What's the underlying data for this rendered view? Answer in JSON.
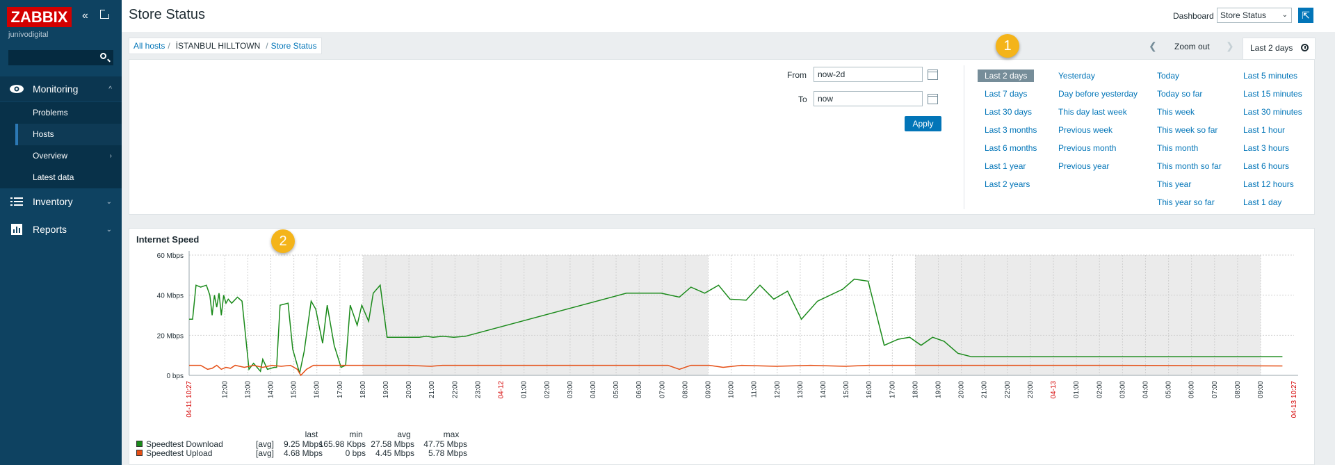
{
  "sidebar": {
    "logo": "ZABBIX",
    "org": "junivodigital",
    "search_placeholder": "",
    "nav": [
      {
        "label": "Monitoring",
        "icon": "eye-icon"
      },
      {
        "label": "Inventory",
        "icon": "list-icon"
      },
      {
        "label": "Reports",
        "icon": "bar-chart-icon"
      }
    ],
    "submenu": [
      "Problems",
      "Hosts",
      "Overview",
      "Latest data"
    ]
  },
  "header": {
    "title": "Store Status",
    "dashboard_label": "Dashboard",
    "dashboard_value": "Store Status"
  },
  "breadcrumb": [
    "All hosts",
    "İSTANBUL HILLTOWN",
    "Store Status"
  ],
  "timebar": {
    "zoom_out": "Zoom out",
    "period": "Last 2 days"
  },
  "filter": {
    "from_label": "From",
    "from_value": "now-2d",
    "to_label": "To",
    "to_value": "now",
    "apply": "Apply",
    "quick_periods": [
      [
        "Last 2 days",
        "Last 7 days",
        "Last 30 days",
        "Last 3 months",
        "Last 6 months",
        "Last 1 year",
        "Last 2 years"
      ],
      [
        "Yesterday",
        "Day before yesterday",
        "This day last week",
        "Previous week",
        "Previous month",
        "Previous year"
      ],
      [
        "Today",
        "Today so far",
        "This week",
        "This week so far",
        "This month",
        "This month so far",
        "This year",
        "This year so far"
      ],
      [
        "Last 5 minutes",
        "Last 15 minutes",
        "Last 30 minutes",
        "Last 1 hour",
        "Last 3 hours",
        "Last 6 hours",
        "Last 12 hours",
        "Last 1 day"
      ]
    ]
  },
  "badges": [
    "1",
    "2"
  ],
  "widget": {
    "title": "Internet Speed"
  },
  "chart_data": {
    "type": "line",
    "title": "Internet Speed",
    "ylabel": "",
    "y_unit": "Mbps",
    "ylim": [
      0,
      60
    ],
    "y_ticks": [
      "0 bps",
      "20 Mbps",
      "40 Mbps",
      "60 Mbps"
    ],
    "x_start_label": "04-11 10:27",
    "x_end_label": "04-13 10:27",
    "x_ticks": [
      "12:00",
      "13:00",
      "14:00",
      "15:00",
      "16:00",
      "17:00",
      "18:00",
      "19:00",
      "20:00",
      "21:00",
      "22:00",
      "23:00",
      "04-12",
      "01:00",
      "02:00",
      "03:00",
      "04:00",
      "05:00",
      "06:00",
      "07:00",
      "08:00",
      "09:00",
      "10:00",
      "11:00",
      "12:00",
      "13:00",
      "14:00",
      "15:00",
      "16:00",
      "17:00",
      "18:00",
      "19:00",
      "20:00",
      "21:00",
      "22:00",
      "23:00",
      "04-13",
      "01:00",
      "02:00",
      "03:00",
      "04:00",
      "05:00",
      "06:00",
      "07:00",
      "08:00",
      "09:00"
    ],
    "red_ticks": [
      "04-12",
      "04-13"
    ],
    "night_shading": [
      [
        "18:00",
        "09:00"
      ],
      [
        "18:00",
        "09:00"
      ]
    ],
    "series": [
      {
        "name": "Speedtest Download",
        "color": "#1a8a1a",
        "points": [
          [
            0,
            28
          ],
          [
            0.15,
            28
          ],
          [
            0.3,
            45
          ],
          [
            0.5,
            44
          ],
          [
            0.75,
            45
          ],
          [
            0.9,
            40
          ],
          [
            1.0,
            30
          ],
          [
            1.1,
            40
          ],
          [
            1.2,
            34
          ],
          [
            1.3,
            41
          ],
          [
            1.4,
            30
          ],
          [
            1.5,
            40
          ],
          [
            1.6,
            36
          ],
          [
            1.7,
            38
          ],
          [
            1.85,
            36
          ],
          [
            2.1,
            39
          ],
          [
            2.3,
            37
          ],
          [
            2.6,
            3
          ],
          [
            2.8,
            6
          ],
          [
            3.1,
            2
          ],
          [
            3.2,
            8
          ],
          [
            3.4,
            3
          ],
          [
            3.7,
            4
          ],
          [
            3.8,
            4
          ],
          [
            3.95,
            35
          ],
          [
            4.3,
            36
          ],
          [
            4.5,
            13
          ],
          [
            4.8,
            1
          ],
          [
            5.0,
            12
          ],
          [
            5.3,
            37
          ],
          [
            5.5,
            33
          ],
          [
            5.8,
            16
          ],
          [
            6.0,
            35
          ],
          [
            6.3,
            15
          ],
          [
            6.6,
            4
          ],
          [
            6.8,
            5
          ],
          [
            7.0,
            35
          ],
          [
            7.3,
            25
          ],
          [
            7.5,
            35
          ],
          [
            7.8,
            27
          ],
          [
            8.0,
            41
          ],
          [
            8.3,
            45
          ],
          [
            8.6,
            19
          ],
          [
            9.0,
            19
          ],
          [
            9.5,
            19
          ],
          [
            10.0,
            19
          ],
          [
            10.3,
            19.5
          ],
          [
            10.6,
            19
          ],
          [
            11.0,
            19.5
          ],
          [
            11.5,
            19
          ],
          [
            12.0,
            19.5
          ],
          [
            19.0,
            41
          ],
          [
            20.5,
            41
          ],
          [
            21.3,
            39
          ],
          [
            21.8,
            44
          ],
          [
            22.4,
            41
          ],
          [
            23.0,
            45
          ],
          [
            23.5,
            38
          ],
          [
            24.2,
            37.5
          ],
          [
            24.8,
            45
          ],
          [
            25.4,
            38
          ],
          [
            26.0,
            42
          ],
          [
            26.6,
            28
          ],
          [
            27.3,
            37
          ],
          [
            28.4,
            43
          ],
          [
            28.9,
            48
          ],
          [
            29.5,
            47
          ],
          [
            30.2,
            15
          ],
          [
            30.8,
            18
          ],
          [
            31.3,
            19
          ],
          [
            31.8,
            15
          ],
          [
            32.3,
            19
          ],
          [
            32.8,
            17
          ],
          [
            33.4,
            11
          ],
          [
            34.0,
            9.25
          ],
          [
            47.5,
            9.25
          ]
        ]
      },
      {
        "name": "Speedtest Upload",
        "color": "#e54e14",
        "points": [
          [
            0,
            5
          ],
          [
            0.5,
            5
          ],
          [
            0.8,
            3
          ],
          [
            1.0,
            3.5
          ],
          [
            1.2,
            5
          ],
          [
            1.4,
            3
          ],
          [
            1.6,
            4
          ],
          [
            1.8,
            3.5
          ],
          [
            2.0,
            5
          ],
          [
            2.4,
            4
          ],
          [
            2.8,
            5
          ],
          [
            3.2,
            4
          ],
          [
            3.6,
            5
          ],
          [
            4.0,
            4.5
          ],
          [
            4.4,
            5
          ],
          [
            4.7,
            3
          ],
          [
            4.85,
            0
          ],
          [
            5.1,
            3
          ],
          [
            5.4,
            5
          ],
          [
            6.0,
            5
          ],
          [
            7.0,
            5
          ],
          [
            8.0,
            5
          ],
          [
            9.0,
            5
          ],
          [
            9.5,
            5
          ],
          [
            10.5,
            4.5
          ],
          [
            11.0,
            5
          ],
          [
            12,
            5
          ],
          [
            19,
            5
          ],
          [
            20.8,
            5
          ],
          [
            21.3,
            3
          ],
          [
            21.8,
            5
          ],
          [
            22.6,
            5
          ],
          [
            23.2,
            4
          ],
          [
            24.0,
            5
          ],
          [
            25.5,
            4.5
          ],
          [
            27.0,
            5
          ],
          [
            28.5,
            4.5
          ],
          [
            29.5,
            5
          ],
          [
            32,
            5
          ],
          [
            40,
            5
          ],
          [
            47.5,
            4.68
          ]
        ]
      }
    ],
    "legend": {
      "headers": [
        "last",
        "min",
        "avg",
        "max"
      ],
      "rows": [
        {
          "name": "Speedtest Download",
          "func": "[avg]",
          "last": "9.25 Mbps",
          "min": "165.98 Kbps",
          "avg": "27.58 Mbps",
          "max": "47.75 Mbps",
          "color": "#1a8a1a"
        },
        {
          "name": "Speedtest Upload",
          "func": "[avg]",
          "last": "4.68 Mbps",
          "min": "0 bps",
          "avg": "4.45 Mbps",
          "max": "5.78 Mbps",
          "color": "#e54e14"
        }
      ]
    }
  }
}
